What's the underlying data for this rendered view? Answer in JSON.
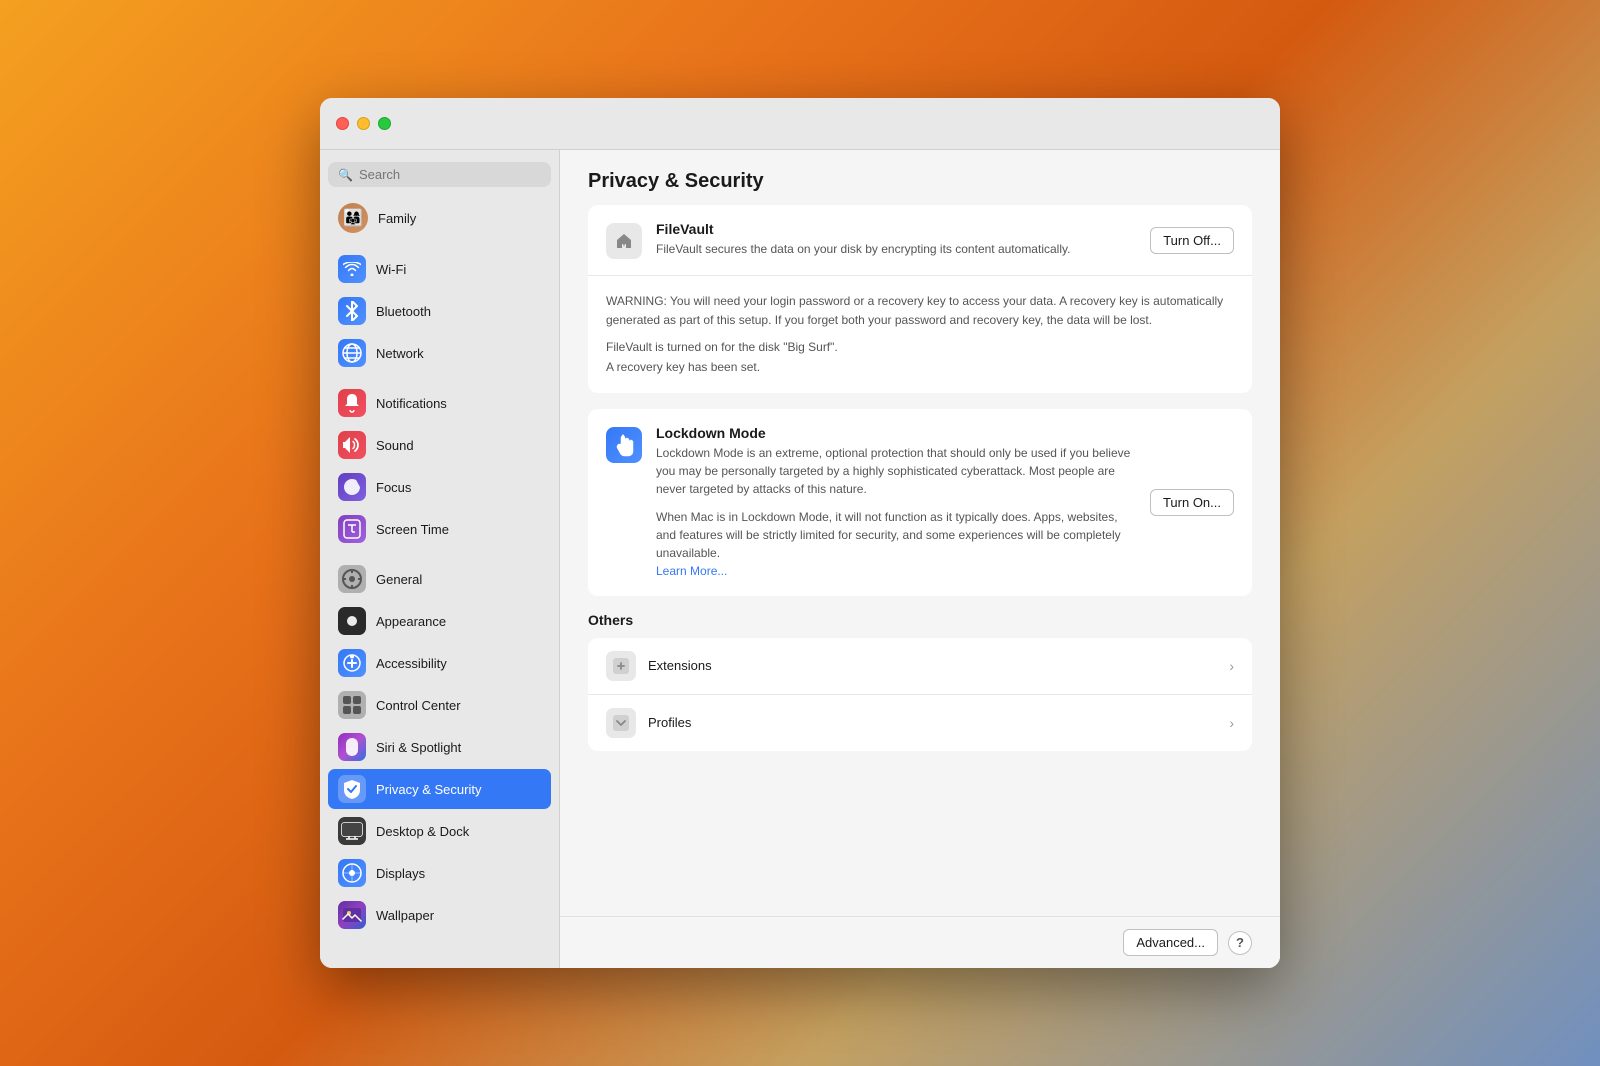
{
  "window": {
    "title": "Privacy & Security"
  },
  "trafficLights": {
    "close": "close",
    "minimize": "minimize",
    "maximize": "maximize"
  },
  "sidebar": {
    "searchPlaceholder": "Search",
    "familyItem": {
      "label": "Family",
      "emoji": "👨‍👩‍👧"
    },
    "items": [
      {
        "id": "wifi",
        "label": "Wi-Fi",
        "iconClass": "icon-wifi",
        "icon": "📶"
      },
      {
        "id": "bluetooth",
        "label": "Bluetooth",
        "iconClass": "icon-bluetooth",
        "icon": "🔷"
      },
      {
        "id": "network",
        "label": "Network",
        "iconClass": "icon-network",
        "icon": "🌐"
      },
      {
        "id": "notifications",
        "label": "Notifications",
        "iconClass": "icon-notifications",
        "icon": "🔔"
      },
      {
        "id": "sound",
        "label": "Sound",
        "iconClass": "icon-sound",
        "icon": "🔊"
      },
      {
        "id": "focus",
        "label": "Focus",
        "iconClass": "icon-focus",
        "icon": "🌙"
      },
      {
        "id": "screentime",
        "label": "Screen Time",
        "iconClass": "icon-screentime",
        "icon": "⏱"
      },
      {
        "id": "general",
        "label": "General",
        "iconClass": "icon-general",
        "icon": "⚙️"
      },
      {
        "id": "appearance",
        "label": "Appearance",
        "iconClass": "icon-appearance",
        "icon": "🎨"
      },
      {
        "id": "accessibility",
        "label": "Accessibility",
        "iconClass": "icon-accessibility",
        "icon": "♿"
      },
      {
        "id": "controlcenter",
        "label": "Control Center",
        "iconClass": "icon-controlcenter",
        "icon": "🎛"
      },
      {
        "id": "siri",
        "label": "Siri & Spotlight",
        "iconClass": "icon-siri",
        "icon": "🎙"
      },
      {
        "id": "privacy",
        "label": "Privacy & Security",
        "iconClass": "icon-privacy",
        "icon": "✋",
        "active": true
      },
      {
        "id": "desktop",
        "label": "Desktop & Dock",
        "iconClass": "icon-desktop",
        "icon": "🖥"
      },
      {
        "id": "displays",
        "label": "Displays",
        "iconClass": "icon-displays",
        "icon": "🌟"
      },
      {
        "id": "wallpaper",
        "label": "Wallpaper",
        "iconClass": "icon-wallpaper",
        "icon": "🖼"
      }
    ]
  },
  "main": {
    "pageTitle": "Privacy & Security",
    "fileVault": {
      "title": "FileVault",
      "description": "FileVault secures the data on your disk by encrypting its content automatically.",
      "buttonLabel": "Turn Off...",
      "warning": "WARNING: You will need your login password or a recovery key to access your data. A recovery key is automatically generated as part of this setup. If you forget both your password and recovery key, the data will be lost.",
      "status1": "FileVault is turned on for the disk \"Big Surf\".",
      "status2": "A recovery key has been set."
    },
    "lockdownMode": {
      "title": "Lockdown Mode",
      "description": "Lockdown Mode is an extreme, optional protection that should only be used if you believe you may be personally targeted by a highly sophisticated cyberattack. Most people are never targeted by attacks of this nature.",
      "detail": "When Mac is in Lockdown Mode, it will not function as it typically does. Apps, websites, and features will be strictly limited for security, and some experiences will be completely unavailable.",
      "learnMore": "Learn More...",
      "buttonLabel": "Turn On..."
    },
    "others": {
      "sectionTitle": "Others",
      "items": [
        {
          "id": "extensions",
          "label": "Extensions"
        },
        {
          "id": "profiles",
          "label": "Profiles"
        }
      ]
    },
    "bottomBar": {
      "advancedButton": "Advanced...",
      "helpButton": "?"
    }
  }
}
